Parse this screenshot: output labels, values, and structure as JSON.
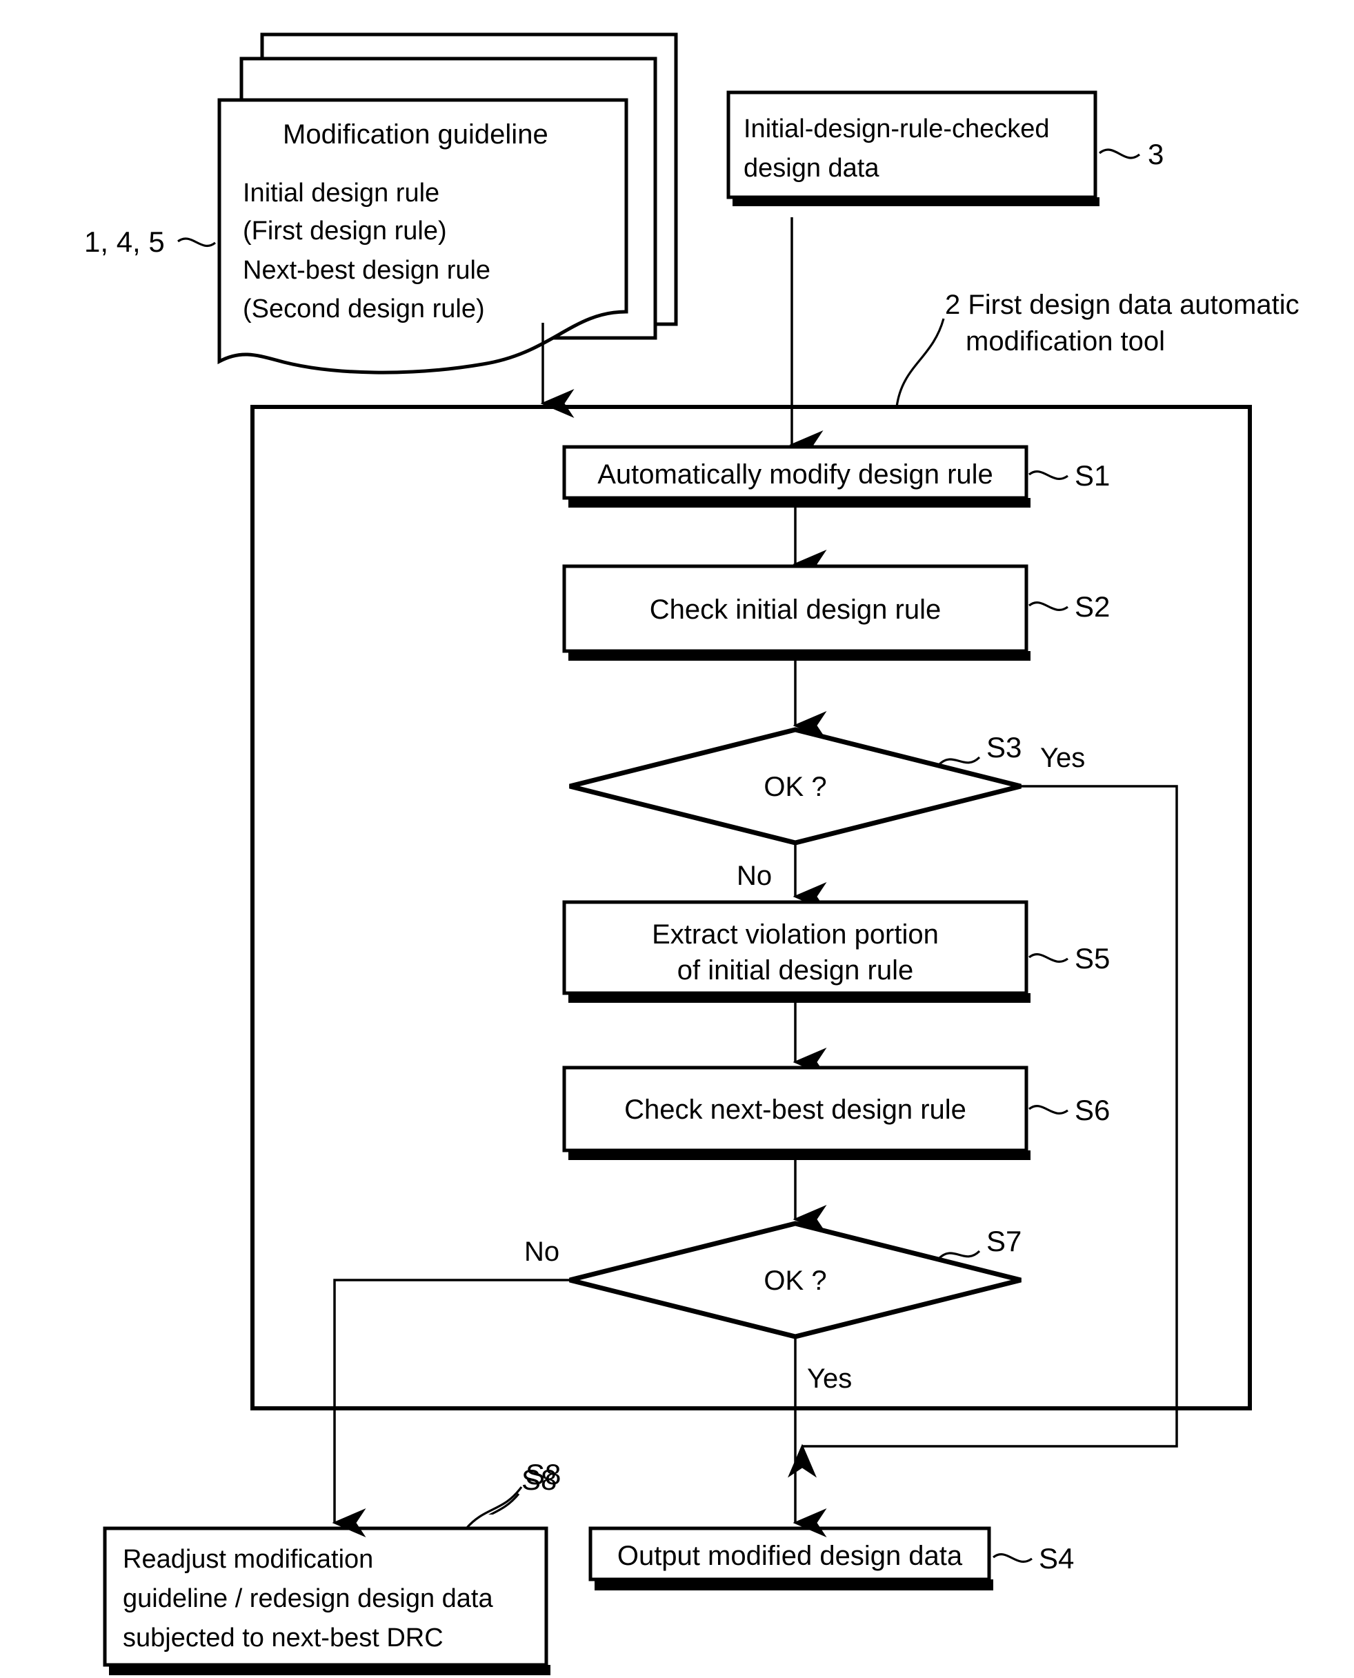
{
  "figure": {
    "type": "patent-flowchart",
    "background": "#ffffff",
    "ink": "#000000"
  },
  "guideline_stack": {
    "ref_label": "1, 4, 5",
    "title": "Modification guideline",
    "lines": [
      "Initial design rule",
      "(First design rule)",
      "Next-best design rule",
      "(Second design rule)"
    ]
  },
  "input_box": {
    "ref_label": "3",
    "line1": "Initial-design-rule-checked",
    "line2": "design data"
  },
  "tool_container": {
    "ref_label": "2",
    "title_line1": "2 First design data automatic",
    "title_line2": "modification tool"
  },
  "steps": {
    "s1": {
      "ref": "S1",
      "label": "Automatically modify design rule"
    },
    "s2": {
      "ref": "S2",
      "label": "Check initial design rule"
    },
    "s3": {
      "ref": "S3",
      "label": "OK ?",
      "yes": "Yes",
      "no": "No"
    },
    "s5": {
      "ref": "S5",
      "line1": "Extract violation portion",
      "line2": "of initial design rule"
    },
    "s6": {
      "ref": "S6",
      "label": "Check next-best design rule"
    },
    "s7": {
      "ref": "S7",
      "label": "OK ?",
      "yes": "Yes",
      "no": "No"
    },
    "s8": {
      "ref": "S8",
      "line1": "Readjust modification",
      "line2": "guideline / redesign design data",
      "line3": "subjected to next-best DRC"
    },
    "s4": {
      "ref": "S4",
      "label": "Output modified design data"
    }
  }
}
